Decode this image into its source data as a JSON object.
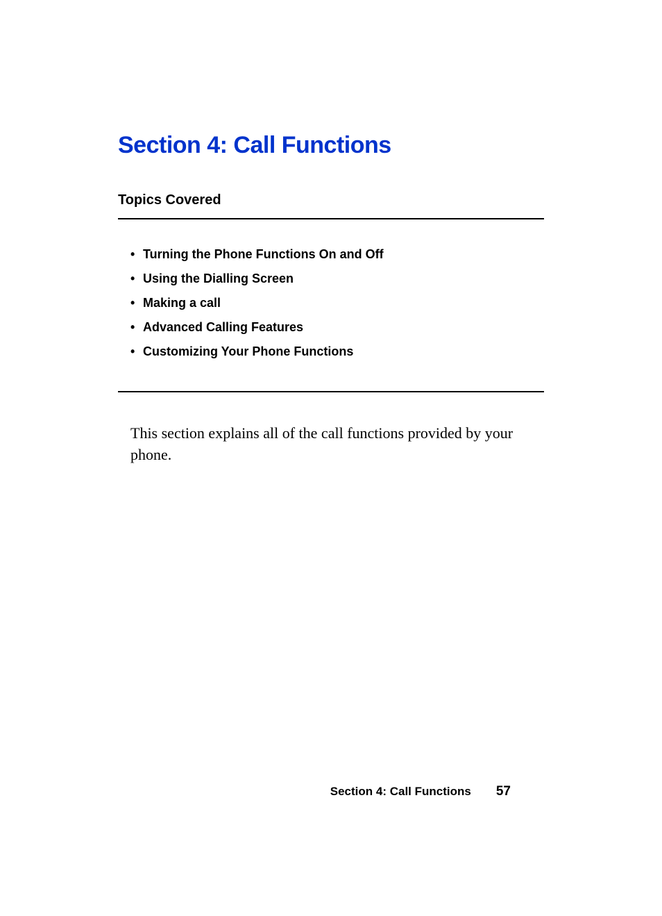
{
  "section": {
    "title": "Section 4: Call Functions",
    "topics_heading": "Topics Covered",
    "topics": [
      "Turning the Phone Functions On and Off",
      "Using the Dialling Screen",
      "Making a call",
      "Advanced Calling Features",
      "Customizing Your Phone Functions"
    ],
    "body": "This section explains all of the call functions provided by your phone."
  },
  "footer": {
    "section_label": "Section 4: Call Functions",
    "page_number": "57"
  }
}
